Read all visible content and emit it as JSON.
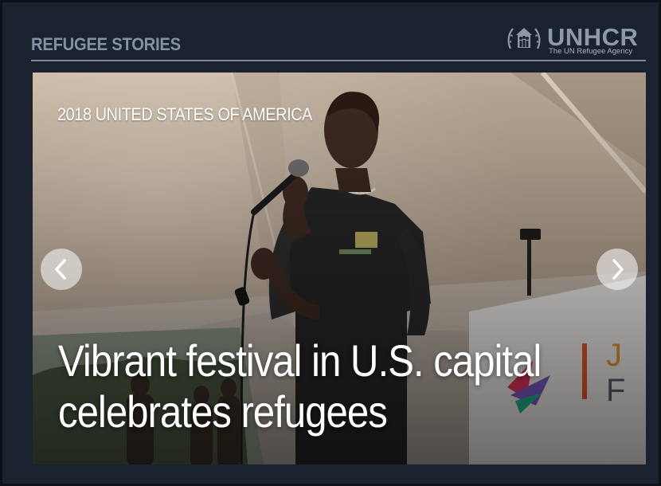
{
  "section": {
    "title": "REFUGEE STORIES"
  },
  "brand": {
    "name": "UNHCR",
    "tagline": "The UN Refugee Agency"
  },
  "slide": {
    "kicker": "2018 UNITED STATES OF AMERICA",
    "headline_line1": "Vibrant festival in U.S. capital",
    "headline_line2": "celebrates refugees"
  },
  "icons": {
    "prev": "chevron-left-icon",
    "next": "chevron-right-icon",
    "logo": "unhcr-emblem-icon"
  },
  "colors": {
    "background": "#1a2230",
    "title": "#8391a5",
    "rule": "#7d8a9c",
    "overlay_text": "#ffffff"
  }
}
